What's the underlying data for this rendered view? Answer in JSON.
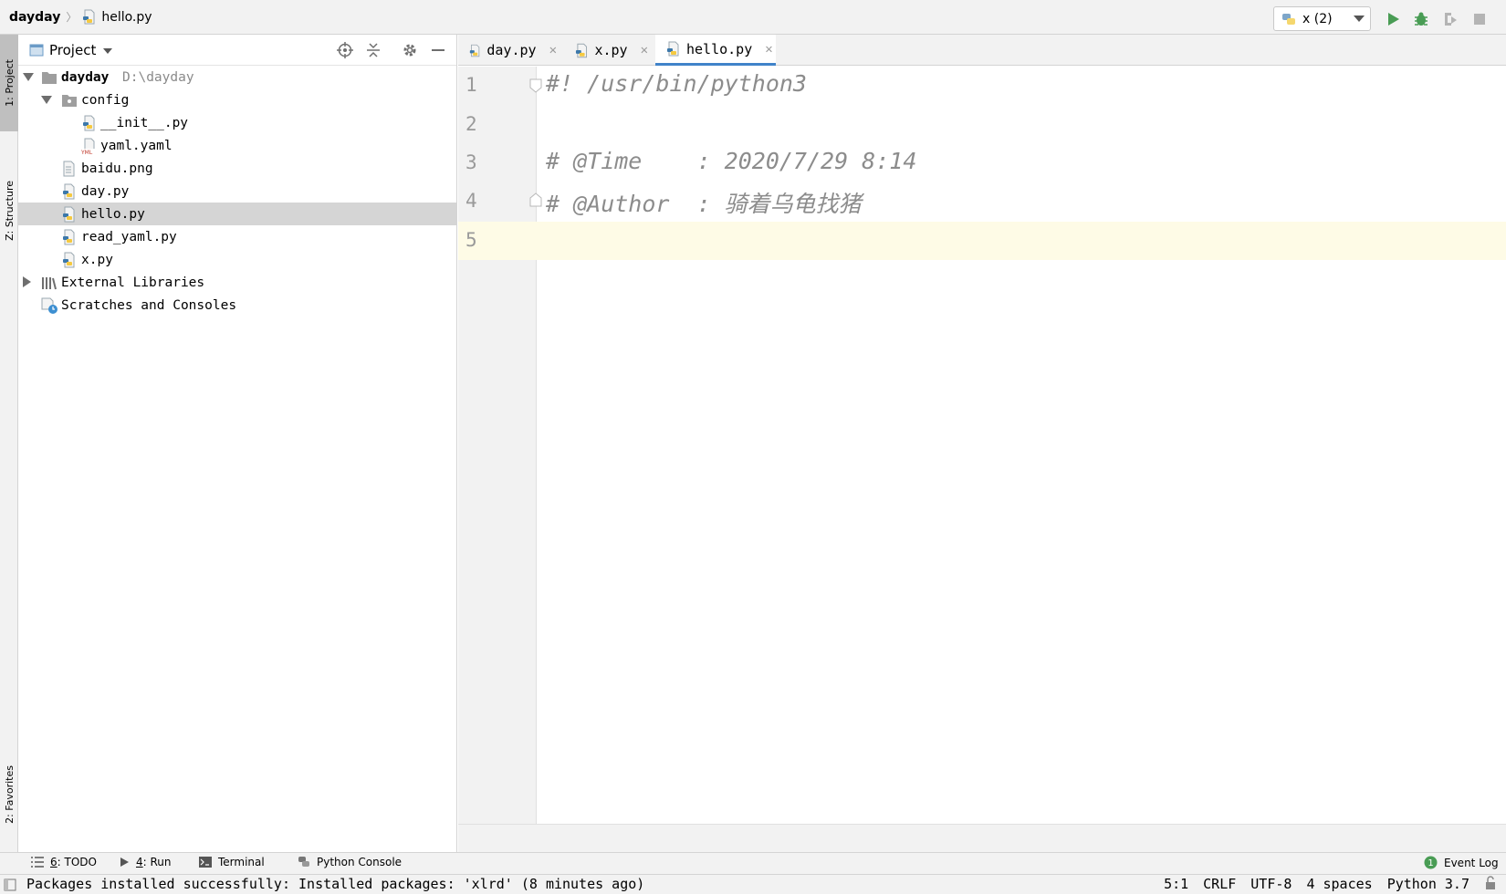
{
  "nav": {
    "project": "dayday",
    "file": "hello.py"
  },
  "run": {
    "config": "x (2)"
  },
  "side_tabs": {
    "project": "1: Project",
    "structure": "Z: Structure",
    "favorites": "2: Favorites"
  },
  "project_panel": {
    "title": "Project"
  },
  "tree": {
    "root_name": "dayday",
    "root_path": "D:\\dayday",
    "config": "config",
    "init_py": "__init__.py",
    "yaml_yaml": "yaml.yaml",
    "baidu_png": "baidu.png",
    "day_py": "day.py",
    "hello_py": "hello.py",
    "read_yaml_py": "read_yaml.py",
    "x_py": "x.py",
    "external_libraries": "External Libraries",
    "scratches": "Scratches and Consoles"
  },
  "tabs": [
    {
      "label": "day.py"
    },
    {
      "label": "x.py"
    },
    {
      "label": "hello.py"
    }
  ],
  "editor": {
    "line_numbers": [
      "1",
      "2",
      "3",
      "4",
      "5"
    ],
    "lines": [
      "#! /usr/bin/python3",
      "",
      "# @Time    : 2020/7/29 8:14",
      "# @Author  : 骑着乌龟找猪",
      ""
    ]
  },
  "tool_windows": {
    "todo_num": "6",
    "todo_label": ": TODO",
    "run_num": "4",
    "run_label": ": Run",
    "terminal": "Terminal",
    "python_console": "Python Console",
    "event_log_count": "1",
    "event_log": "Event Log"
  },
  "status": {
    "message": "Packages installed successfully: Installed packages: 'xlrd' (8 minutes ago)",
    "position": "5:1",
    "line_sep": "CRLF",
    "encoding": "UTF-8",
    "indent": "4 spaces",
    "interpreter": "Python 3.7"
  },
  "colors": {
    "accent": "#4083c9",
    "run_green": "#499c54",
    "comment": "#8c8c8c"
  }
}
